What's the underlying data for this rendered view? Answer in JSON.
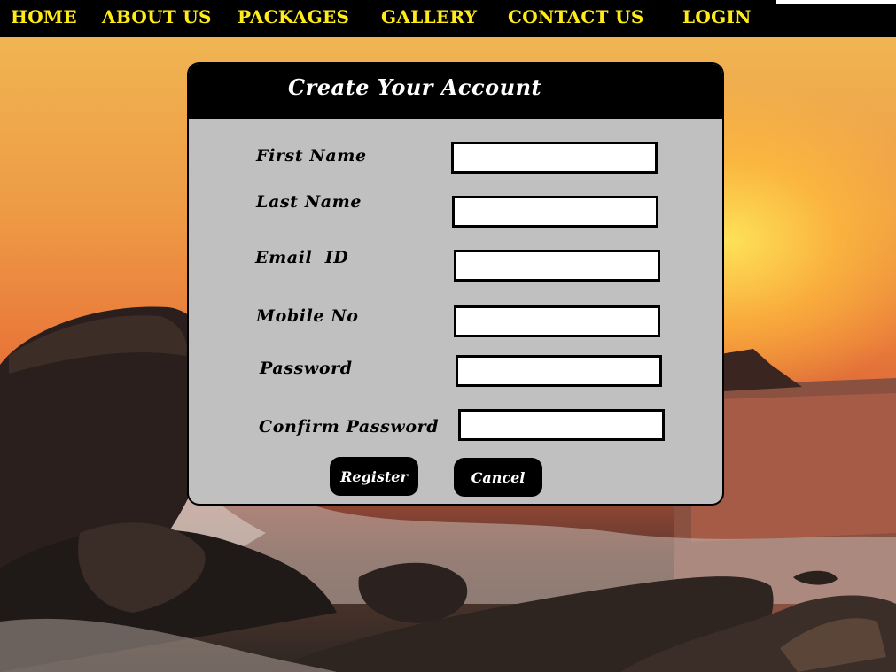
{
  "nav": {
    "items": [
      {
        "label": "HOME"
      },
      {
        "label": "ABOUT US"
      },
      {
        "label": "PACKAGES"
      },
      {
        "label": "GALLERY"
      },
      {
        "label": "CONTACT US"
      },
      {
        "label": "LOGIN"
      }
    ],
    "text_color": "#ffeb1a",
    "background": "#000000"
  },
  "form": {
    "title": "Create Your Account",
    "fields": [
      {
        "label": "First Name",
        "value": "",
        "placeholder": ""
      },
      {
        "label": "Last Name",
        "value": "",
        "placeholder": ""
      },
      {
        "label": "Email  ID",
        "value": "",
        "placeholder": ""
      },
      {
        "label": "Mobile No",
        "value": "",
        "placeholder": ""
      },
      {
        "label": "Password",
        "value": "",
        "placeholder": ""
      },
      {
        "label": "Confirm Password",
        "value": "",
        "placeholder": ""
      }
    ],
    "register_label": "Register",
    "cancel_label": "Cancel",
    "panel_background": "#c0c0c0"
  }
}
